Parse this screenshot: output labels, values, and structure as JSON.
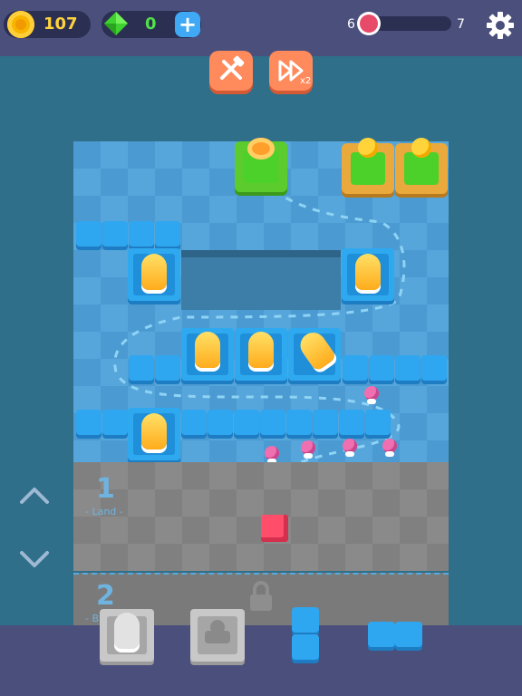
{
  "hud": {
    "coins": "107",
    "gems": "0",
    "plus_icon": "plus-icon",
    "wave_current": "6",
    "wave_total": "7",
    "wave_progress": 0.1,
    "settings_icon": "gear-icon"
  },
  "controls": {
    "build_icon": "hammer-wrench-icon",
    "speed_icon": "fast-forward-icon",
    "speed_label": "x2"
  },
  "zones": [
    {
      "number": "1",
      "label": "- Land -"
    },
    {
      "number": "2",
      "label": "- B"
    }
  ],
  "colors": {
    "accent_orange": "#ff8a5c",
    "hud_bar": "#4a4f7c",
    "coin_yellow": "#ffd33d",
    "gem_green": "#52e04a",
    "enemy_pink": "#f06fb0",
    "crystal_red": "#ff4d6a"
  }
}
